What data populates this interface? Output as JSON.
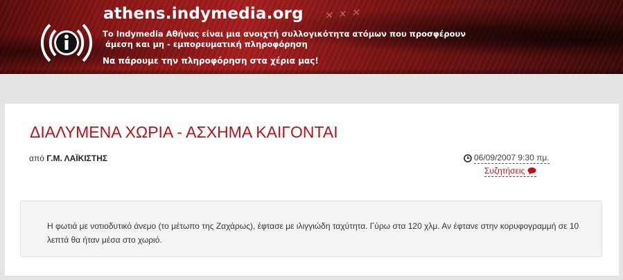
{
  "header": {
    "site_title": "athens.indymedia.org",
    "tagline_line1": "Το Indymedia Αθήνας είναι μια ανοιχτή συλλογικότητα ατόμων που προσφέρουν",
    "tagline_line2": "άμεση και μη - εμπορευματική πληροφόρηση",
    "slogan": "Να πάρουμε την πληροφόρηση στα χέρια μας!",
    "logo_icon": "indymedia-i-logo-icon",
    "background_color": "#8f1717"
  },
  "article": {
    "title": "ΔΙΑΛΥΜΕΝΑ ΧΩΡΙΑ - ΑΣΧΗΜΑ ΚΑΙΓΟΝΤΑΙ",
    "byline_prefix": "από",
    "author": "Γ.Μ. ΛΑΪΚΙΣΤΗΣ",
    "date": "06/09/2007 9:30 πμ.",
    "comments_label": "Συζητήσεις",
    "summary": "Η φωτιά με νοτιοδυτικό άνεμο (το μέτωπο της Ζαχάρως), έφτασε με ιλιγγιώδη ταχύτητα. Γύρω στα 120 χλμ. Αν έφτανε στην κορυφογραμμή σε 10 λεπτά θα ήταν μέσα στο χωριό.",
    "title_color": "#b5121b",
    "clock_icon": "clock-icon",
    "comment_icon": "comment-icon"
  }
}
